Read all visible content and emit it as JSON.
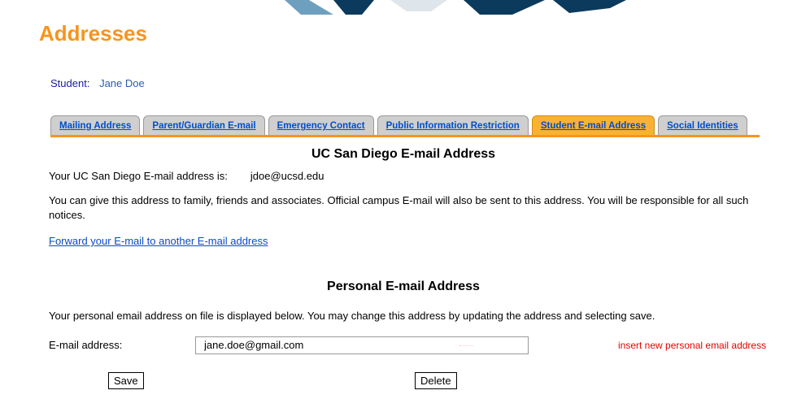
{
  "page": {
    "title": "Addresses"
  },
  "student": {
    "label": "Student:",
    "name": "Jane Doe"
  },
  "tabs": [
    {
      "label": "Mailing Address",
      "active": false
    },
    {
      "label": "Parent/Guardian E-mail",
      "active": false
    },
    {
      "label": "Emergency Contact",
      "active": false
    },
    {
      "label": "Public Information Restriction",
      "active": false
    },
    {
      "label": "Student E-mail Address",
      "active": true
    },
    {
      "label": "Social Identities",
      "active": false
    }
  ],
  "uc_section": {
    "heading": "UC San Diego E-mail Address",
    "label": "Your UC San Diego E-mail address is:",
    "value": "jdoe@ucsd.edu",
    "description": "You can give this address to family, friends and associates. Official campus E-mail will also be sent to this address. You will be responsible for all such notices.",
    "forward_link": "Forward your E-mail to another E-mail address"
  },
  "personal_section": {
    "heading": "Personal E-mail Address",
    "description": "Your personal email address on file is displayed below. You may change this address by updating the address and selecting save.",
    "field_label": "E-mail address:",
    "field_value": "jane.doe@gmail.com",
    "annotation": "insert new personal email address"
  },
  "buttons": {
    "save": "Save",
    "delete": "Delete"
  }
}
